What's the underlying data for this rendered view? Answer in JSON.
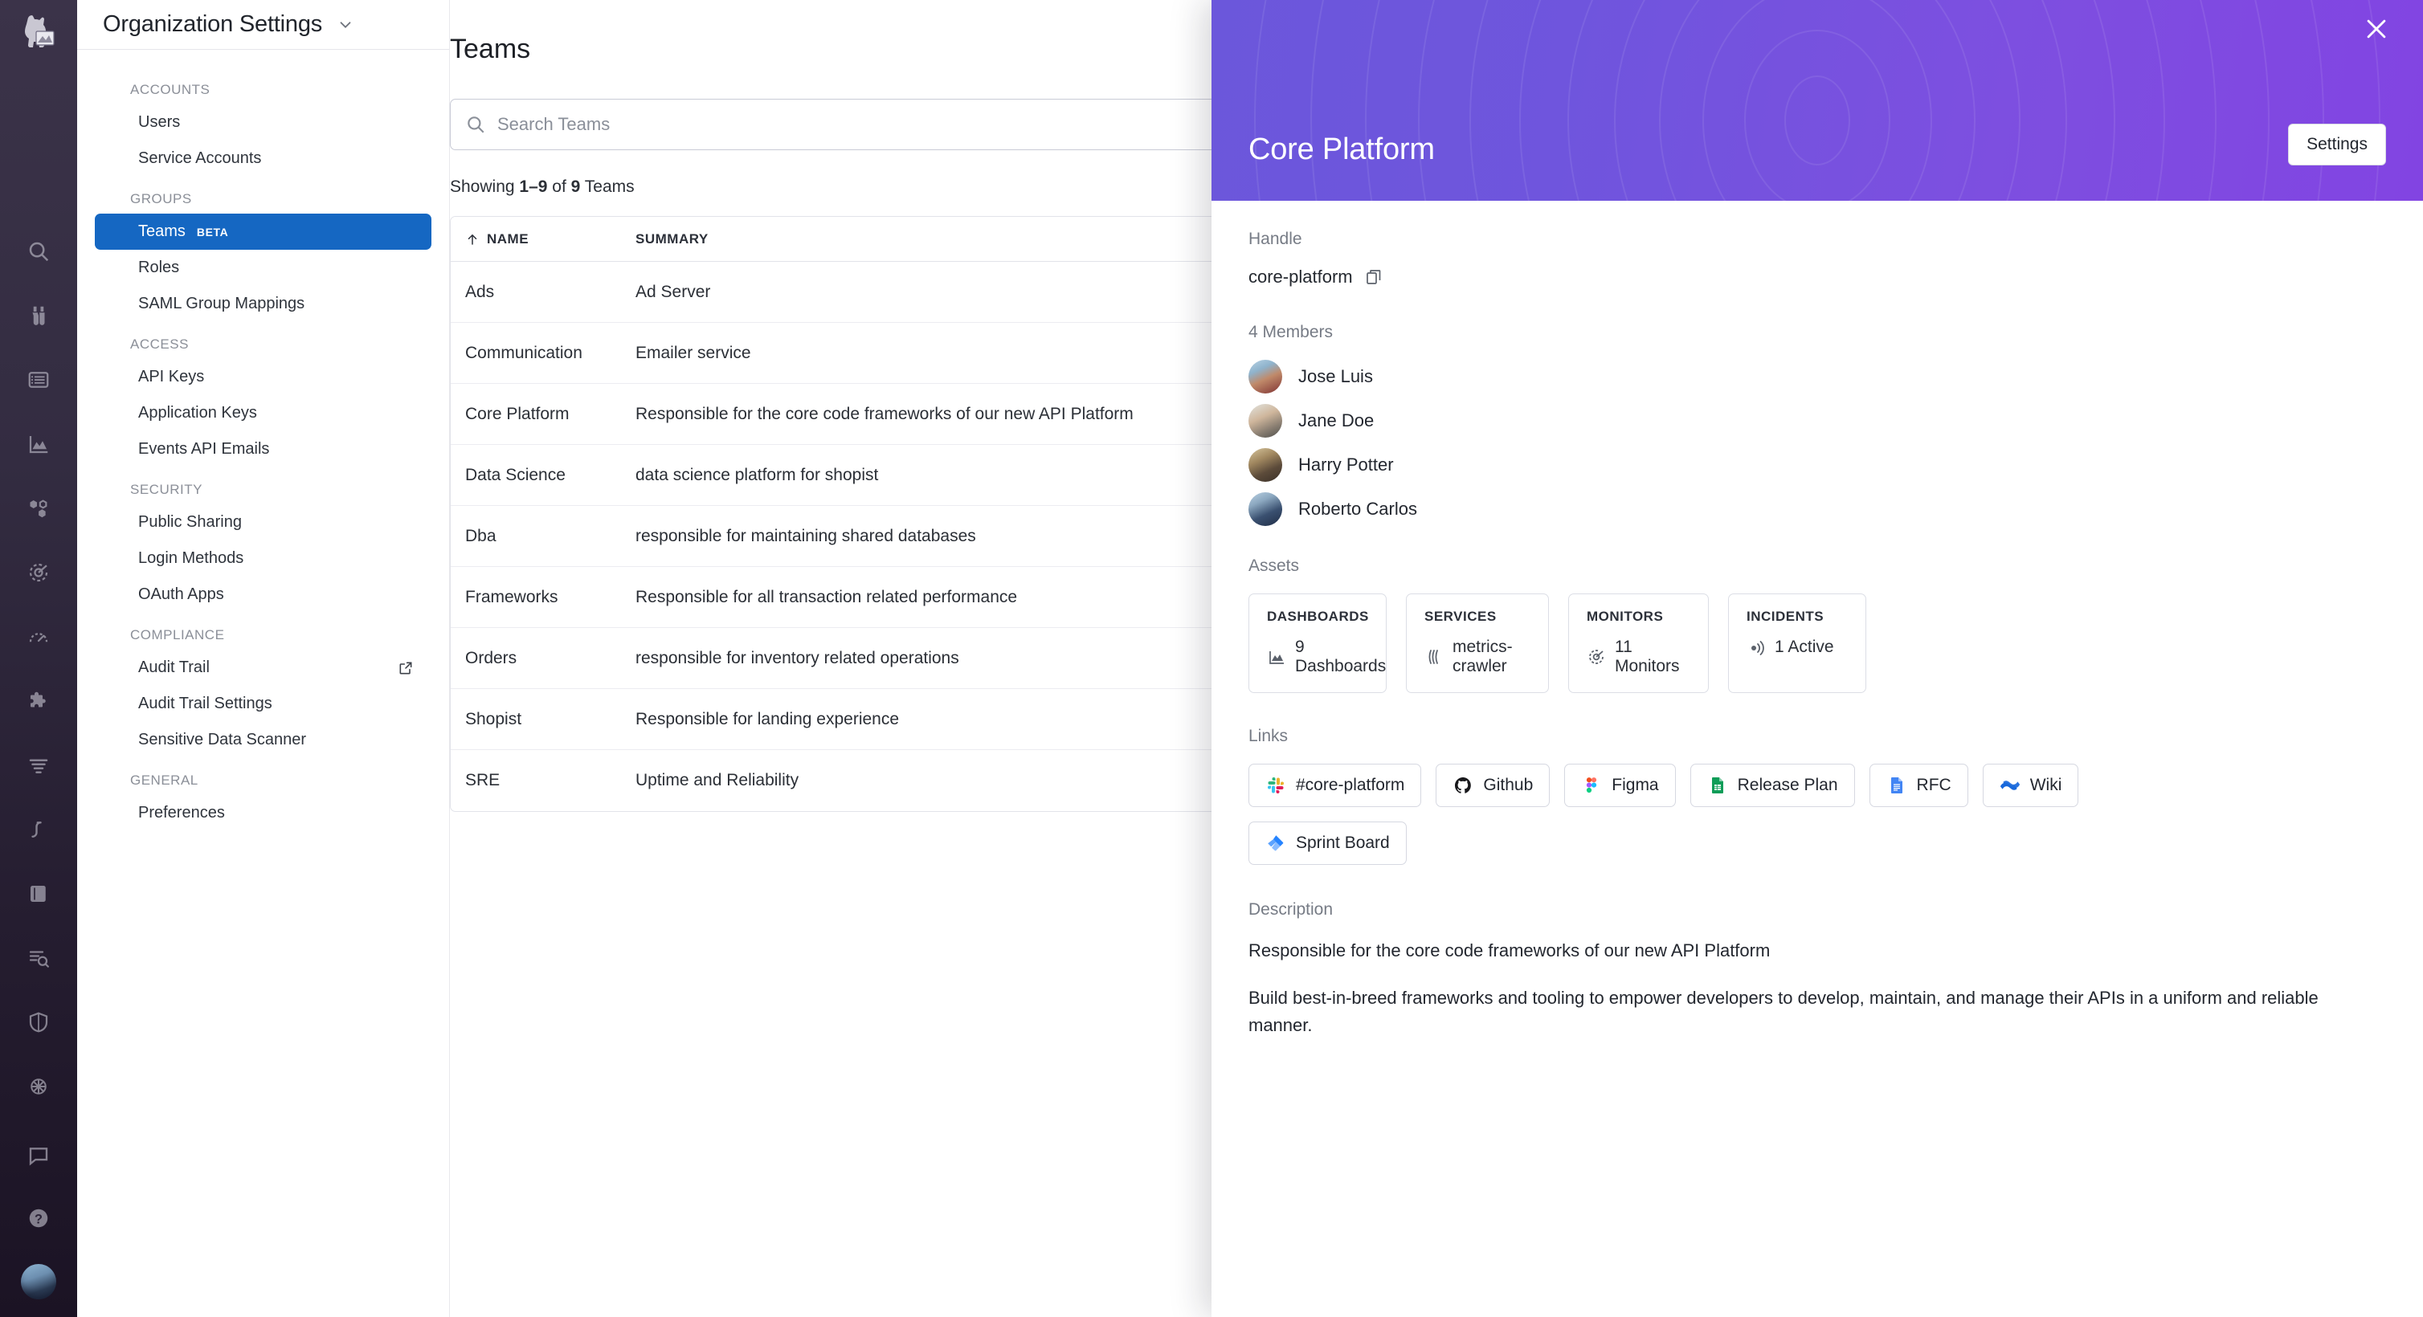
{
  "rail": {
    "logo_icon": "datadog-dog-logo",
    "icons": [
      {
        "name": "search-icon"
      },
      {
        "name": "binoculars-watchdog-icon"
      },
      {
        "name": "list-logs-icon"
      },
      {
        "name": "area-chart-metrics-icon"
      },
      {
        "name": "hexagons-apm-icon"
      },
      {
        "name": "target-synthetics-icon"
      },
      {
        "name": "gauge-rum-icon"
      },
      {
        "name": "puzzle-integrations-icon"
      },
      {
        "name": "filter-pipelines-icon"
      },
      {
        "name": "link-service-map-icon"
      },
      {
        "name": "book-notebooks-icon"
      },
      {
        "name": "search-profile-icon"
      },
      {
        "name": "shield-security-icon"
      },
      {
        "name": "network-globe-icon"
      }
    ],
    "bottom_icons": [
      {
        "name": "chat-support-icon"
      },
      {
        "name": "help-question-icon"
      },
      {
        "name": "user-avatar"
      }
    ]
  },
  "nav": {
    "title": "Organization Settings",
    "chevron_icon": "chevron-down-icon",
    "groups": [
      {
        "label": "ACCOUNTS",
        "items": [
          {
            "label": "Users",
            "active": false,
            "badge": "",
            "external": false
          },
          {
            "label": "Service Accounts",
            "active": false,
            "badge": "",
            "external": false
          }
        ]
      },
      {
        "label": "GROUPS",
        "items": [
          {
            "label": "Teams",
            "active": true,
            "badge": "BETA",
            "external": false
          },
          {
            "label": "Roles",
            "active": false,
            "badge": "",
            "external": false
          },
          {
            "label": "SAML Group Mappings",
            "active": false,
            "badge": "",
            "external": false
          }
        ]
      },
      {
        "label": "ACCESS",
        "items": [
          {
            "label": "API Keys",
            "active": false,
            "badge": "",
            "external": false
          },
          {
            "label": "Application Keys",
            "active": false,
            "badge": "",
            "external": false
          },
          {
            "label": "Events API Emails",
            "active": false,
            "badge": "",
            "external": false
          }
        ]
      },
      {
        "label": "SECURITY",
        "items": [
          {
            "label": "Public Sharing",
            "active": false,
            "badge": "",
            "external": false
          },
          {
            "label": "Login Methods",
            "active": false,
            "badge": "",
            "external": false
          },
          {
            "label": "OAuth Apps",
            "active": false,
            "badge": "",
            "external": false
          }
        ]
      },
      {
        "label": "COMPLIANCE",
        "items": [
          {
            "label": "Audit Trail",
            "active": false,
            "badge": "",
            "external": true
          },
          {
            "label": "Audit Trail Settings",
            "active": false,
            "badge": "",
            "external": false
          },
          {
            "label": "Sensitive Data Scanner",
            "active": false,
            "badge": "",
            "external": false
          }
        ]
      },
      {
        "label": "GENERAL",
        "items": [
          {
            "label": "Preferences",
            "active": false,
            "badge": "",
            "external": false
          }
        ]
      }
    ]
  },
  "main": {
    "title": "Teams",
    "search": {
      "placeholder": "Search Teams",
      "value": "",
      "icon": "search-icon"
    },
    "showing": {
      "prefix": "Showing ",
      "range": "1–9",
      "middle": " of ",
      "total": "9",
      "suffix": " Teams"
    },
    "table": {
      "sort_icon": "arrow-up-icon",
      "columns": [
        "NAME",
        "SUMMARY"
      ],
      "rows": [
        {
          "name": "Ads",
          "summary": "Ad Server"
        },
        {
          "name": "Communication",
          "summary": "Emailer service"
        },
        {
          "name": "Core Platform",
          "summary": "Responsible for the core code frameworks of our new API Platform"
        },
        {
          "name": "Data Science",
          "summary": "data science platform for shopist"
        },
        {
          "name": "Dba",
          "summary": "responsible for maintaining shared databases"
        },
        {
          "name": "Frameworks",
          "summary": "Responsible for all transaction related performance"
        },
        {
          "name": "Orders",
          "summary": "responsible for inventory related operations"
        },
        {
          "name": "Shopist",
          "summary": "Responsible for landing experience"
        },
        {
          "name": "SRE",
          "summary": "Uptime and Reliability"
        }
      ]
    }
  },
  "panel": {
    "title": "Core Platform",
    "settings_button": "Settings",
    "close_icon": "close-icon",
    "handle_label": "Handle",
    "handle_value": "core-platform",
    "copy_icon": "copy-icon",
    "members_label": "4 Members",
    "members": [
      {
        "name": "Jose Luis",
        "avatar": "member-avatar"
      },
      {
        "name": "Jane Doe",
        "avatar": "member-avatar"
      },
      {
        "name": "Harry Potter",
        "avatar": "member-avatar"
      },
      {
        "name": "Roberto Carlos",
        "avatar": "member-avatar"
      }
    ],
    "assets_label": "Assets",
    "assets": [
      {
        "kind": "DASHBOARDS",
        "value": "9 Dashboards",
        "icon": "dashboard-chart-icon"
      },
      {
        "kind": "SERVICES",
        "value": "metrics-crawler",
        "icon": "services-layers-icon"
      },
      {
        "kind": "MONITORS",
        "value": "11 Monitors",
        "icon": "monitor-target-icon"
      },
      {
        "kind": "INCIDENTS",
        "value": "1 Active",
        "icon": "incident-siren-icon"
      }
    ],
    "links_label": "Links",
    "links": [
      {
        "label": "#core-platform",
        "icon": "slack-icon"
      },
      {
        "label": "Github",
        "icon": "github-icon"
      },
      {
        "label": "Figma",
        "icon": "figma-icon"
      },
      {
        "label": "Release Plan",
        "icon": "google-sheets-icon"
      },
      {
        "label": "RFC",
        "icon": "google-docs-icon"
      },
      {
        "label": "Wiki",
        "icon": "confluence-icon"
      },
      {
        "label": "Sprint Board",
        "icon": "jira-icon"
      }
    ],
    "description_label": "Description",
    "description_paragraphs": [
      "Responsible for the core code frameworks of our new API Platform",
      "Build best-in-breed frameworks and tooling to empower developers to develop, maintain, and manage their APIs in a uniform and reliable manner."
    ]
  },
  "colors": {
    "accent_blue": "#1567c2",
    "panel_gradient_start": "#6b57db",
    "panel_gradient_end": "#8244e2",
    "rail_dark": "#332c41"
  }
}
